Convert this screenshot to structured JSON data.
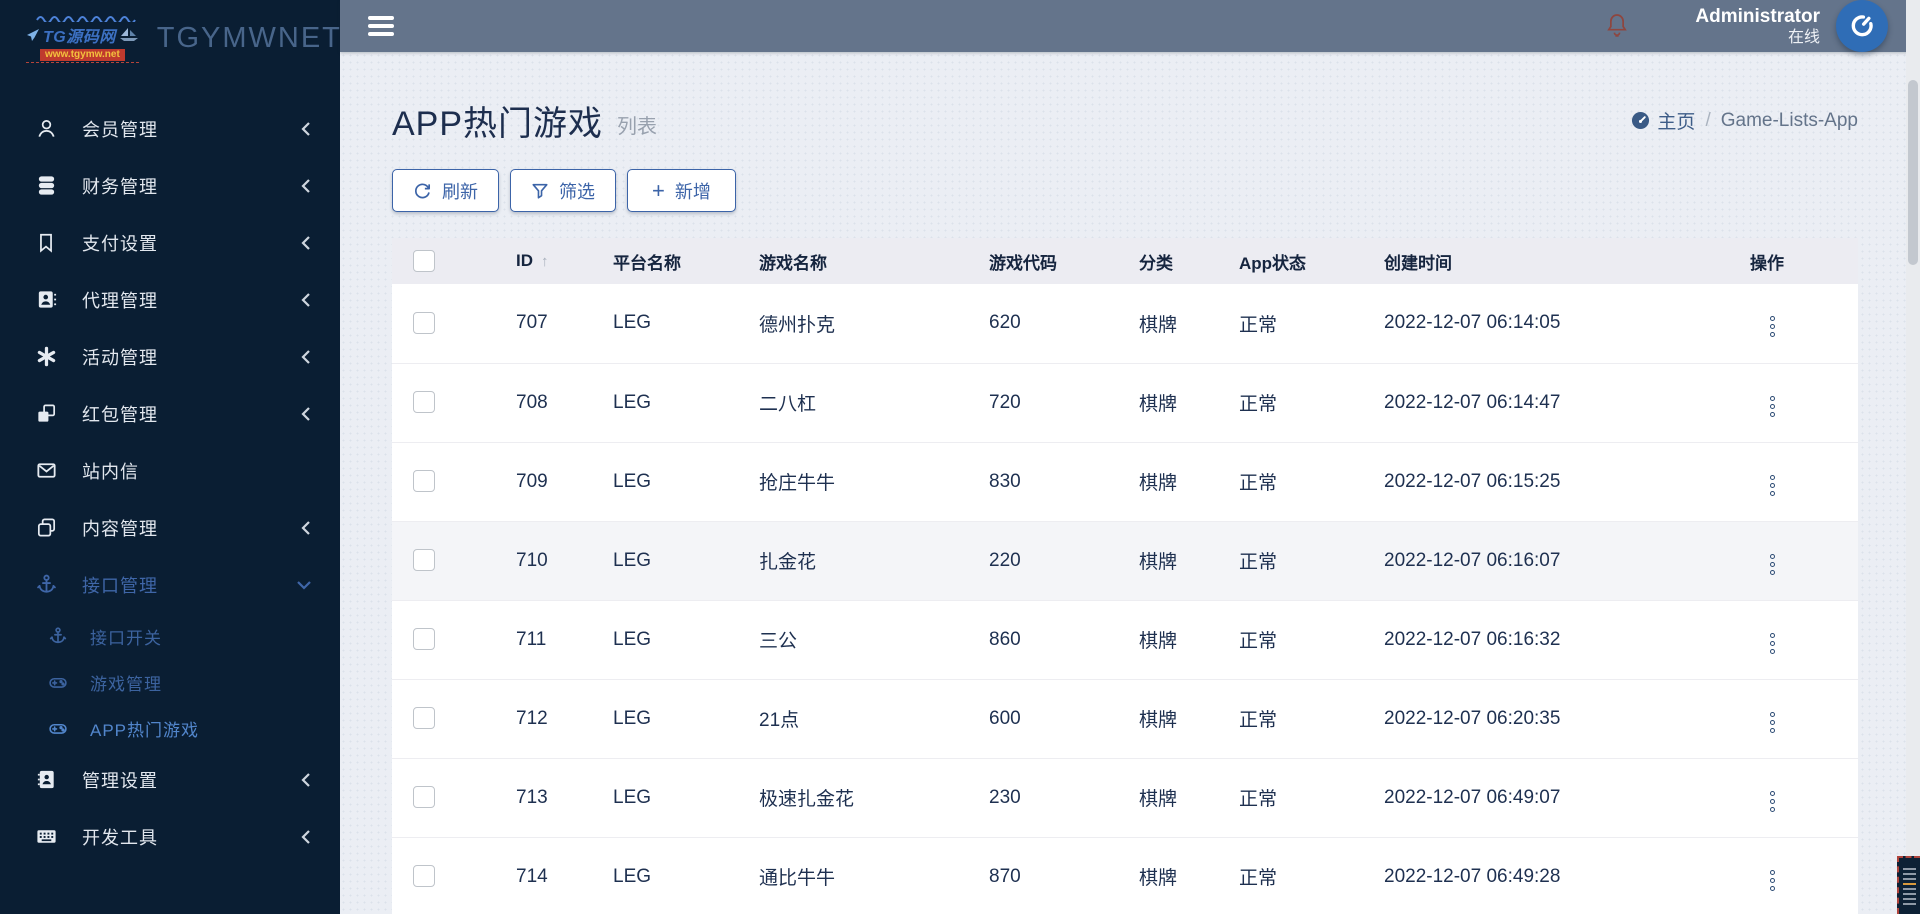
{
  "brand": {
    "app_name": "TGYMWNET",
    "logo_text": "TG源码网",
    "logo_url": "www.tgymw.net"
  },
  "topbar": {
    "user_name": "Administrator",
    "user_status": "在线"
  },
  "sidebar": {
    "items": [
      {
        "label": "会员管理"
      },
      {
        "label": "财务管理"
      },
      {
        "label": "支付设置"
      },
      {
        "label": "代理管理"
      },
      {
        "label": "活动管理"
      },
      {
        "label": "红包管理"
      },
      {
        "label": "站内信"
      },
      {
        "label": "内容管理"
      },
      {
        "label": "接口管理"
      }
    ],
    "subitems": [
      {
        "label": "接口开关"
      },
      {
        "label": "游戏管理"
      },
      {
        "label": "APP热门游戏",
        "active": true
      }
    ],
    "bottom_items": [
      {
        "label": "管理设置"
      },
      {
        "label": "开发工具"
      }
    ]
  },
  "page": {
    "title": "APP热门游戏",
    "subtitle": "列表",
    "breadcrumb": {
      "home": "主页",
      "separator": "/",
      "current": "Game-Lists-App"
    }
  },
  "toolbar": {
    "refresh": "刷新",
    "filter": "筛选",
    "add": "新增"
  },
  "table": {
    "columns": {
      "id": "ID",
      "platform": "平台名称",
      "game_name": "游戏名称",
      "game_code": "游戏代码",
      "category": "分类",
      "app_status": "App状态",
      "created_at": "创建时间",
      "actions": "操作"
    },
    "sort_indicator": "↑",
    "rows": [
      {
        "id": "707",
        "platform": "LEG",
        "name": "德州扑克",
        "code": "620",
        "category": "棋牌",
        "status": "正常",
        "created": "2022-12-07 06:14:05"
      },
      {
        "id": "708",
        "platform": "LEG",
        "name": "二八杠",
        "code": "720",
        "category": "棋牌",
        "status": "正常",
        "created": "2022-12-07 06:14:47"
      },
      {
        "id": "709",
        "platform": "LEG",
        "name": "抢庄牛牛",
        "code": "830",
        "category": "棋牌",
        "status": "正常",
        "created": "2022-12-07 06:15:25"
      },
      {
        "id": "710",
        "platform": "LEG",
        "name": "扎金花",
        "code": "220",
        "category": "棋牌",
        "status": "正常",
        "created": "2022-12-07 06:16:07",
        "highlighted": true
      },
      {
        "id": "711",
        "platform": "LEG",
        "name": "三公",
        "code": "860",
        "category": "棋牌",
        "status": "正常",
        "created": "2022-12-07 06:16:32"
      },
      {
        "id": "712",
        "platform": "LEG",
        "name": "21点",
        "code": "600",
        "category": "棋牌",
        "status": "正常",
        "created": "2022-12-07 06:20:35"
      },
      {
        "id": "713",
        "platform": "LEG",
        "name": "极速扎金花",
        "code": "230",
        "category": "棋牌",
        "status": "正常",
        "created": "2022-12-07 06:49:07"
      },
      {
        "id": "714",
        "platform": "LEG",
        "name": "通比牛牛",
        "code": "870",
        "category": "棋牌",
        "status": "正常",
        "created": "2022-12-07 06:49:28"
      }
    ]
  },
  "colors": {
    "accent_blue": "#3c64a8",
    "sidebar_bg": "#0a1e33",
    "topbar_bg": "#64748b",
    "avatar_blue": "#2f6db6",
    "bell_red": "#8e463f"
  }
}
